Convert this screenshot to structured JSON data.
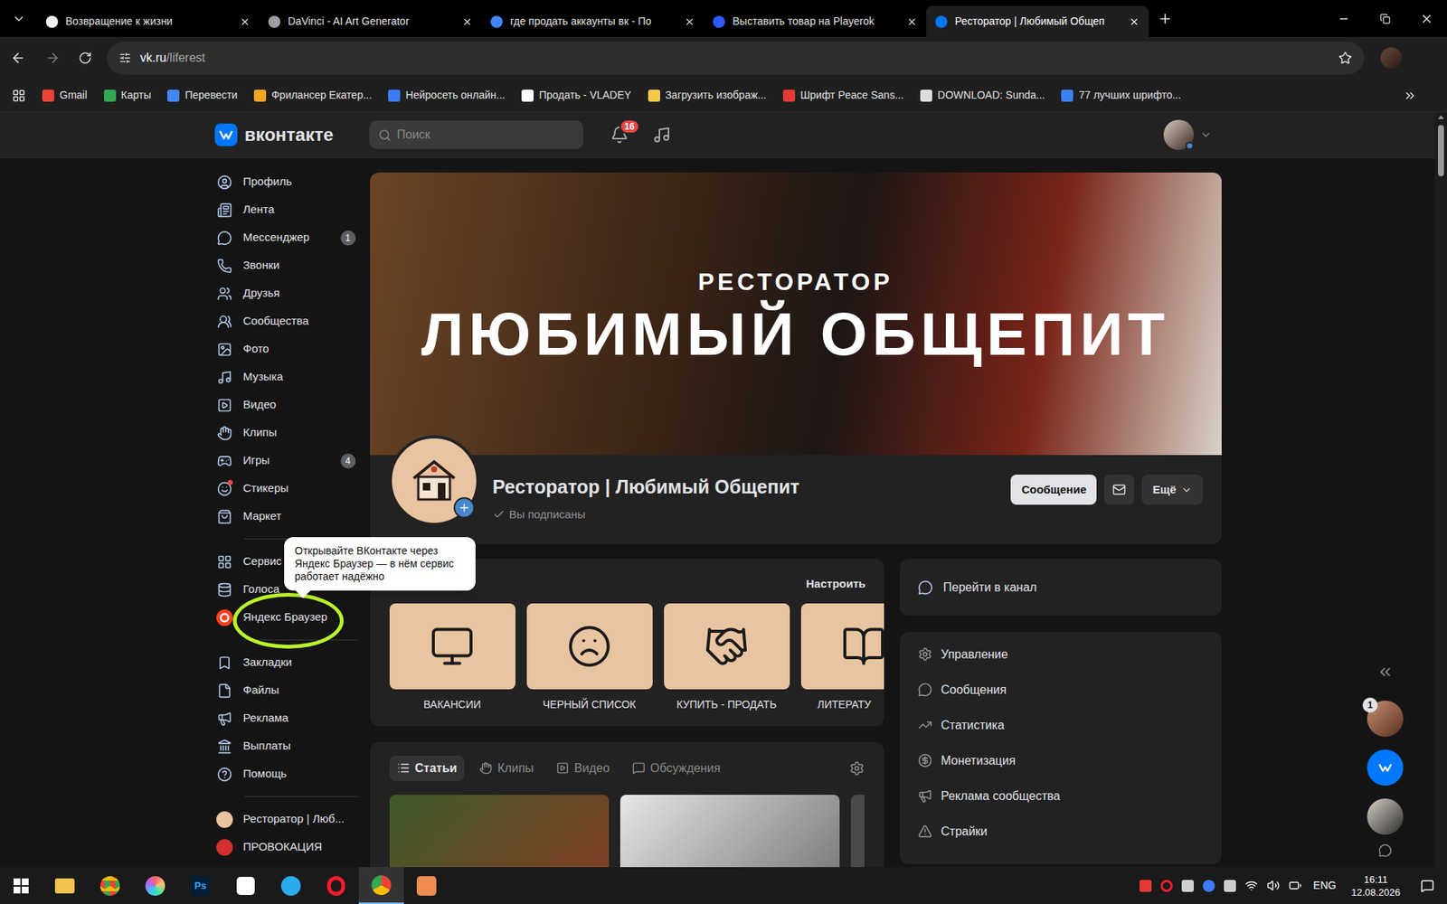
{
  "browser": {
    "tabs": [
      {
        "title": "Возвращение к жизни",
        "selected": false
      },
      {
        "title": "DaVinci - AI Art Generator",
        "selected": false
      },
      {
        "title": "где продать аккаунты вк - По",
        "selected": false
      },
      {
        "title": "Выставить товар на Playerok",
        "selected": false
      },
      {
        "title": "Ресторатор | Любимый Общеп",
        "selected": true
      }
    ],
    "address": {
      "host": "vk.ru",
      "path": "/liferest"
    },
    "bookmarks": [
      "Gmail",
      "Карты",
      "Перевести",
      "Фрилансер Екатер...",
      "Нейросеть онлайн...",
      "Продать - VLADEY",
      "Загрузить изображ...",
      "Шрифт Peace Sans...",
      "DOWNLOAD: Sunda...",
      "77 лучших шрифто..."
    ]
  },
  "vk": {
    "logo": "вконтакте",
    "search": {
      "placeholder": "Поиск"
    },
    "notifications": "16",
    "nav": [
      [
        {
          "label": "Профиль"
        },
        {
          "label": "Лента"
        },
        {
          "label": "Мессенджер",
          "badge": "1"
        },
        {
          "label": "Звонки"
        },
        {
          "label": "Друзья"
        },
        {
          "label": "Сообщества"
        },
        {
          "label": "Фото"
        },
        {
          "label": "Музыка"
        },
        {
          "label": "Видео"
        },
        {
          "label": "Клипы"
        },
        {
          "label": "Игры",
          "badge": "4"
        },
        {
          "label": "Стикеры",
          "dot": true
        },
        {
          "label": "Маркет"
        }
      ],
      [
        {
          "label": "Сервис"
        },
        {
          "label": "Голоса"
        },
        {
          "label": "Яндекс Браузер",
          "highlighted": true
        }
      ],
      [
        {
          "label": "Закладки"
        },
        {
          "label": "Файлы"
        },
        {
          "label": "Реклама"
        },
        {
          "label": "Выплаты"
        },
        {
          "label": "Помощь"
        }
      ]
    ],
    "shortcuts": [
      "Ресторатор | Люб...",
      "ПРОВОКАЦИЯ"
    ],
    "tooltip": "Открывайте ВКонтакте через Яндекс Браузер — в нём сервис работает надёжно",
    "community": {
      "cover_subtitle": "РЕСТОРАТОР",
      "cover_title": "ЛЮБИМЫЙ ОБЩЕПИТ",
      "name": "Ресторатор | Любимый Общепит",
      "status": "Вы подписаны",
      "subscribed": true,
      "message_button": "Сообщение",
      "more_button": "Ещё"
    },
    "menu": {
      "action": "Настроить",
      "items": [
        "ВАКАНСИИ",
        "ЧЕРНЫЙ СПИСОК",
        "КУПИТЬ - ПРОДАТЬ",
        "ЛИТЕРАТУ"
      ]
    },
    "content_tabs": [
      {
        "label": "Статьи",
        "selected": true
      },
      {
        "label": "Клипы",
        "selected": false
      },
      {
        "label": "Видео",
        "selected": false
      },
      {
        "label": "Обсуждения",
        "selected": false
      }
    ],
    "channel_link": "Перейти в канал",
    "admin_menu": [
      "Управление",
      "Сообщения",
      "Статистика",
      "Монетизация",
      "Реклама сообщества",
      "Страйки"
    ],
    "chat_dock": {
      "unread": "1"
    }
  },
  "taskbar": {
    "photoshop_label": "Ps",
    "language": "ENG",
    "time": "16:11",
    "date": "12.08.2026"
  }
}
